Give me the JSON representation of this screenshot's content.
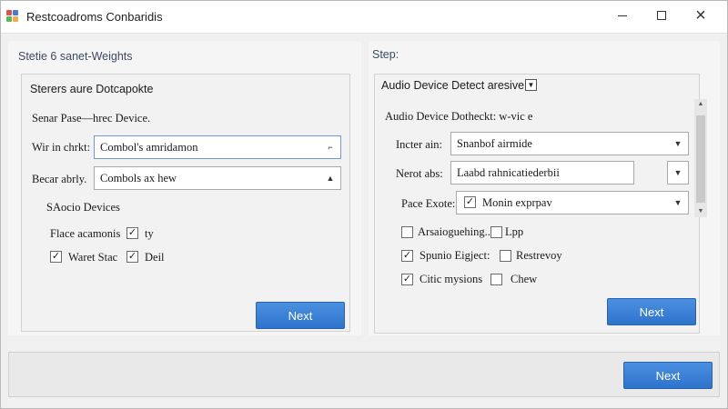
{
  "window": {
    "title": "Restcoadroms Conbaridis",
    "controls": {
      "minimize": "minimize",
      "maximize": "maximize",
      "close": "×"
    }
  },
  "left_panel": {
    "heading": "Stetie 6 sanet-Weights",
    "group_title": "Sterers aure Dotcapokte",
    "subtitle": "Senar Pase—hrec Device.",
    "fields": [
      {
        "label": "Wir in chrkt:",
        "value": "Combol's amridamon",
        "arrow": "⌐"
      },
      {
        "label": "Becar abrly.",
        "value": "Combols ax hew",
        "arrow": "▲"
      }
    ],
    "section_label": "SAocio Devices",
    "checks": [
      {
        "label": "Flace acamonis",
        "after": "ty",
        "checked": true
      },
      {
        "label": "Waret Stac",
        "after": "Deil",
        "checked": true
      }
    ],
    "next_label": "Next"
  },
  "right_panel": {
    "heading": "Step:",
    "group_title": "Audio Device Detect aresive",
    "subtitle": "Audio Device Dotheckt: w-vic e",
    "fields": [
      {
        "label": "Incter ain:",
        "value": "Snanbof airmide"
      },
      {
        "label": "Nerot abs:",
        "value": "Laabd rahnicatiederbii"
      },
      {
        "label": "Pace Exote:",
        "value": "Monin exprpav",
        "checked": true
      }
    ],
    "checks": [
      {
        "label": "Arsaioguehing..",
        "after": "Lpp",
        "checked": false,
        "after_checked": false
      },
      {
        "label": "Spunio Eigject:",
        "after": "Restrevoy",
        "checked": true,
        "after_checked": false
      },
      {
        "label": "Citic mysions",
        "after": "Chew",
        "checked": true,
        "after_checked": false
      }
    ],
    "next_label": "Next"
  },
  "footer": {
    "next_label": "Next"
  },
  "colors": {
    "primary_button": "#2f74cc",
    "heading": "#3b4a63"
  }
}
